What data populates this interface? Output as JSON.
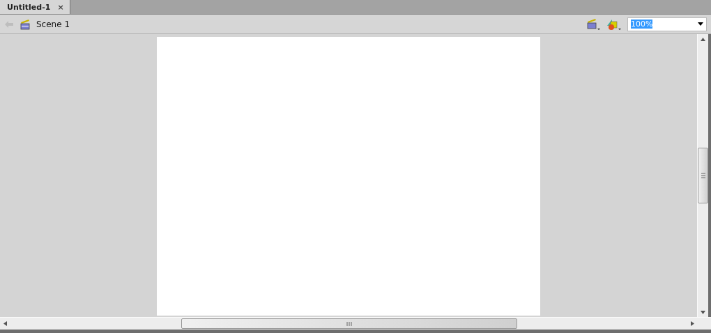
{
  "tabs": [
    {
      "label": "Untitled-1",
      "close": "×",
      "selected": true
    }
  ],
  "toolbar": {
    "back_disabled": true,
    "scene": "Scene 1",
    "zoom": {
      "value": "100%",
      "text_selected": true
    }
  }
}
